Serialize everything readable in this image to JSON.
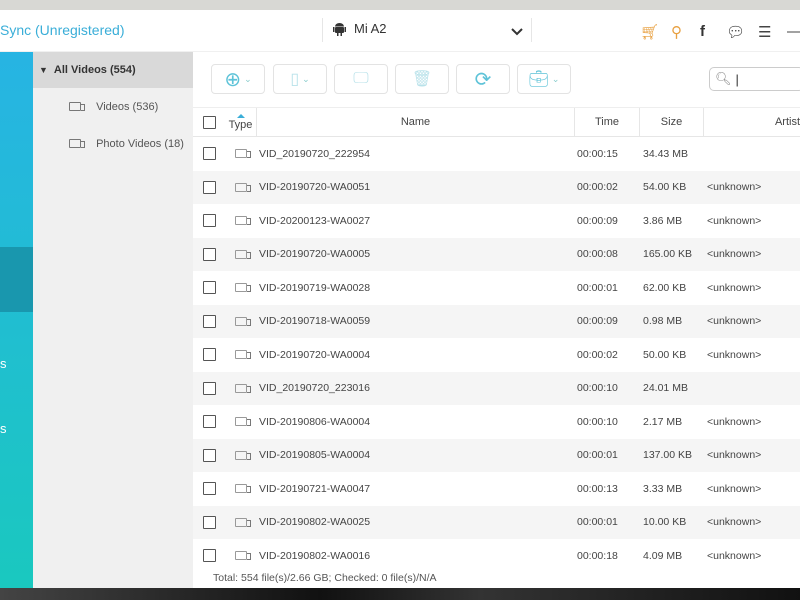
{
  "titlebar": {
    "app_title": "Sync (Unregistered)",
    "device": "Mi A2"
  },
  "icons": {
    "cart": "cart-icon",
    "key": "key-icon",
    "facebook": "facebook-icon",
    "feedback": "feedback-icon",
    "menu": "menu-icon",
    "minimize": "minimize-icon"
  },
  "colors": {
    "accent": "#3aaed8",
    "sidebar_top": "#27b4e3",
    "sidebar_bottom": "#1ac8bf",
    "sidebar_selected": "#1997ae",
    "shop": "#e8a040"
  },
  "leftbar": {
    "fragments": [
      "s",
      "s"
    ]
  },
  "tree": {
    "all": "All Videos (554)",
    "items": [
      {
        "label": "Videos (536)"
      },
      {
        "label": "Photo Videos (18)"
      }
    ]
  },
  "table": {
    "headers": {
      "type": "Type",
      "name": "Name",
      "time": "Time",
      "size": "Size",
      "artist": "Artist"
    },
    "rows": [
      {
        "name": "VID_20190720_222954",
        "time": "00:00:15",
        "size": "34.43 MB",
        "artist": ""
      },
      {
        "name": "VID-20190720-WA0051",
        "time": "00:00:02",
        "size": "54.00 KB",
        "artist": "<unknown>"
      },
      {
        "name": "VID-20200123-WA0027",
        "time": "00:00:09",
        "size": "3.86 MB",
        "artist": "<unknown>"
      },
      {
        "name": "VID-20190720-WA0005",
        "time": "00:00:08",
        "size": "165.00 KB",
        "artist": "<unknown>"
      },
      {
        "name": "VID-20190719-WA0028",
        "time": "00:00:01",
        "size": "62.00 KB",
        "artist": "<unknown>"
      },
      {
        "name": "VID-20190718-WA0059",
        "time": "00:00:09",
        "size": "0.98 MB",
        "artist": "<unknown>"
      },
      {
        "name": "VID-20190720-WA0004",
        "time": "00:00:02",
        "size": "50.00 KB",
        "artist": "<unknown>"
      },
      {
        "name": "VID_20190720_223016",
        "time": "00:00:10",
        "size": "24.01 MB",
        "artist": ""
      },
      {
        "name": "VID-20190806-WA0004",
        "time": "00:00:10",
        "size": "2.17 MB",
        "artist": "<unknown>"
      },
      {
        "name": "VID-20190805-WA0004",
        "time": "00:00:01",
        "size": "137.00 KB",
        "artist": "<unknown>"
      },
      {
        "name": "VID-20190721-WA0047",
        "time": "00:00:13",
        "size": "3.33 MB",
        "artist": "<unknown>"
      },
      {
        "name": "VID-20190802-WA0025",
        "time": "00:00:01",
        "size": "10.00 KB",
        "artist": "<unknown>"
      },
      {
        "name": "VID-20190802-WA0016",
        "time": "00:00:18",
        "size": "4.09 MB",
        "artist": "<unknown>"
      }
    ]
  },
  "footer": {
    "status": "Total: 554 file(s)/2.66 GB; Checked: 0 file(s)/N/A"
  }
}
